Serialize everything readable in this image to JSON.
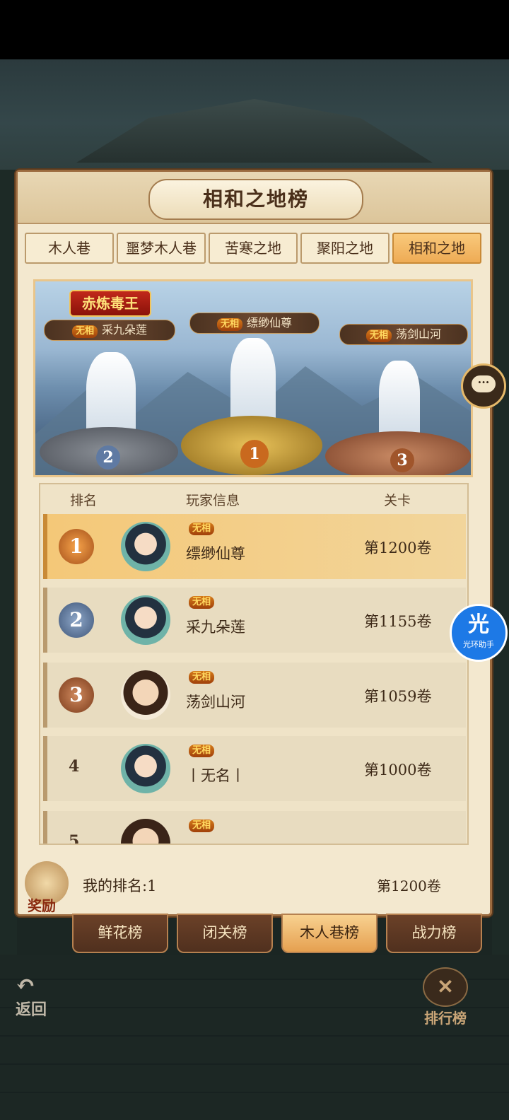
{
  "panel": {
    "title": "相和之地榜"
  },
  "tabs": [
    "木人巷",
    "噩梦木人巷",
    "苦寒之地",
    "聚阳之地",
    "相和之地"
  ],
  "active_tab": 4,
  "podium": {
    "banner_label": "赤炼毒王",
    "players": [
      {
        "rank": "2",
        "name": "采九朵莲",
        "tag": "无相"
      },
      {
        "rank": "1",
        "name": "缥缈仙尊",
        "tag": "无相"
      },
      {
        "rank": "3",
        "name": "荡剑山河",
        "tag": "无相"
      }
    ]
  },
  "list": {
    "headers": {
      "rank": "排名",
      "info": "玩家信息",
      "stage": "关卡"
    },
    "rows": [
      {
        "rank": "1",
        "tag": "无相",
        "name": "缥缈仙尊",
        "stage": "第1200卷"
      },
      {
        "rank": "2",
        "tag": "无相",
        "name": "采九朵莲",
        "stage": "第1155卷"
      },
      {
        "rank": "3",
        "tag": "无相",
        "name": "荡剑山河",
        "stage": "第1059卷"
      },
      {
        "rank": "4",
        "tag": "无相",
        "name": "丨无名丨",
        "stage": "第1000卷"
      },
      {
        "rank": "5",
        "tag": "无相",
        "name": "",
        "stage": ""
      }
    ]
  },
  "footer": {
    "reward_label": "奖励",
    "my_rank": "我的排名:1",
    "my_stage": "第1200卷"
  },
  "bottom_tabs": [
    "鲜花榜",
    "闭关榜",
    "木人巷榜",
    "战力榜"
  ],
  "active_bottom_tab": 2,
  "nav": {
    "back_label": "返回",
    "rank_label": "排行榜"
  },
  "float_button": {
    "glyph": "光",
    "label": "光环助手"
  },
  "colors": {
    "gold": "#f2b25c",
    "silver": "#5f7aa3",
    "bronze": "#a0552b",
    "panel": "#f3e8cf"
  }
}
